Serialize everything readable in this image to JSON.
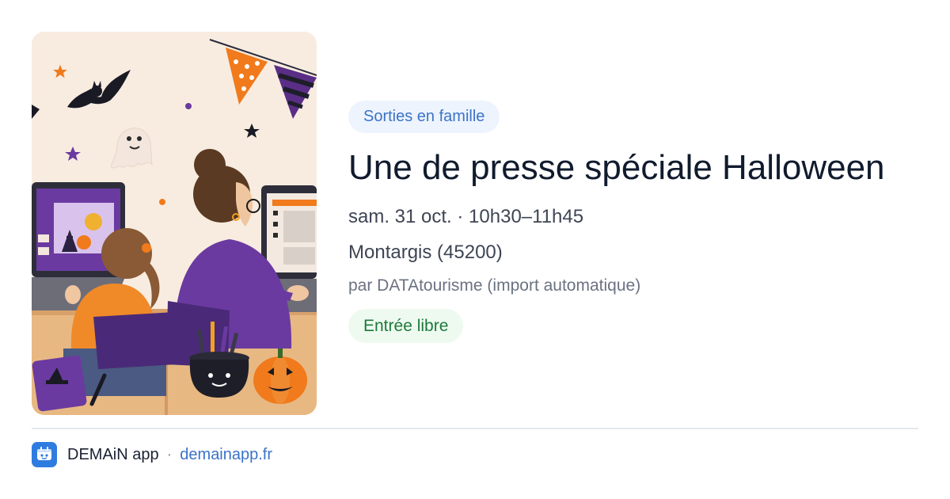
{
  "event": {
    "category": "Sorties en famille",
    "title": "Une de presse spéciale Halloween",
    "datetime": "sam. 31 oct. · 10h30–11h45",
    "location": "Montargis (45200)",
    "organizer": "par DATAtourisme (import automatique)",
    "price": "Entrée libre"
  },
  "footer": {
    "app_name": "DEMAiN app",
    "separator": "·",
    "domain": "demainapp.fr"
  },
  "hero": {
    "icon": "halloween-illustration"
  },
  "colors": {
    "accent": "#3b73c8",
    "category_bg": "#eef4fd",
    "price_text": "#1d7a3a",
    "price_bg": "#eefaf0",
    "title": "#111b2e",
    "logo": "#2f7ce0"
  }
}
